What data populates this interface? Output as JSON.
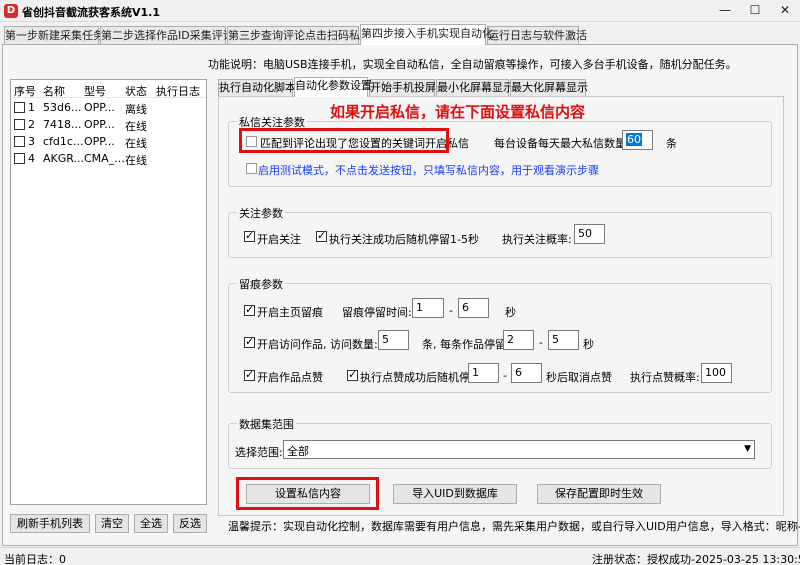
{
  "window": {
    "title": "省创抖音截流获客系统V1.1",
    "icon_letter": "D",
    "brand_color": "#d32f2f",
    "minimize": "—",
    "maximize": "☐",
    "close": "✕"
  },
  "top_tabs": [
    "第一步新建采集任务",
    "第二步选择作品ID采集评论",
    "第三步查询评论点击扫码私信",
    "第四步接入手机实现自动化",
    "运行日志与软件激活"
  ],
  "function_desc": "功能说明：电脑USB连接手机，实现全自动私信，全自动留痕等操作，可接入多台手机设备，随机分配任务。",
  "device_list": {
    "headers": [
      "序号",
      "名称",
      "型号",
      "状态",
      "执行日志"
    ],
    "rows": [
      {
        "index": "1",
        "name": "53d6...",
        "model": "OPP...",
        "status": "离线",
        "log": ""
      },
      {
        "index": "2",
        "name": "7418...",
        "model": "OPP...",
        "status": "在线",
        "log": ""
      },
      {
        "index": "3",
        "name": "cfd1c...",
        "model": "OPP...",
        "status": "在线",
        "log": ""
      },
      {
        "index": "4",
        "name": "AKGR...",
        "model": "CMA_...",
        "status": "在线",
        "log": ""
      }
    ]
  },
  "list_buttons": {
    "refresh": "刷新手机列表",
    "clear": "清空",
    "select_all": "全选",
    "invert": "反选"
  },
  "inner_tabs": [
    "执行自动化脚本",
    "自动化参数设置",
    "开始手机投屏",
    "最小化屏幕显示",
    "最大化屏幕显示"
  ],
  "hint_text": "如果开启私信，请在下面设置私信内容",
  "private_msg": {
    "title": "私信关注参数",
    "match_keyword_label": "匹配到评论出现了您设置的关键词开启私信",
    "max_per_day_label": "每台设备每天最大私信数量:",
    "max_per_day_value": "60",
    "unit": "条",
    "test_mode_label": "启用测试模式，不点击发送按钮，只填写私信内容，用于观看演示步骤"
  },
  "follow": {
    "title": "关注参数",
    "enable_follow": "开启关注",
    "stay_after_follow": "执行关注成功后随机停留1-5秒",
    "prob_label": "执行关注概率:",
    "prob_value": "50"
  },
  "trace": {
    "title": "留痕参数",
    "home_trace": "开启主页留痕",
    "stay_time_label": "留痕停留时间:",
    "stay_min": "1",
    "dash": "-",
    "stay_max": "6",
    "sec": "秒",
    "visit_works": "开启访问作品, 访问数量:",
    "visit_count": "5",
    "per_work_stay": "条, 每条作品停留",
    "work_stay_min": "2",
    "work_stay_max": "5",
    "like_works": "开启作品点赞",
    "like_stay": "执行点赞成功后随机停留",
    "like_stay_min": "1",
    "like_stay_max": "6",
    "cancel_like": "秒后取消点赞",
    "like_prob_label": "执行点赞概率:",
    "like_prob_value": "100"
  },
  "dataset": {
    "title": "数据集范围",
    "range_label": "选择范围:",
    "range_value": "全部"
  },
  "action_buttons": {
    "set_msg": "设置私信内容",
    "import_uid": "导入UID到数据库",
    "save_config": "保存配置即时生效"
  },
  "tip": "温馨提示：实现自动化控制，数据库需要有用户信息，需先采集用户数据，或自行导入UID用户信息，导入格式：昵称----UID",
  "status": {
    "left": "当前日志：0",
    "right": "注册状态：授权成功-2025-03-25 13:30:53.000"
  },
  "colors": {
    "highlight_red": "#e01010",
    "link_blue": "#1a3cff",
    "selection_blue": "#0078d7"
  }
}
